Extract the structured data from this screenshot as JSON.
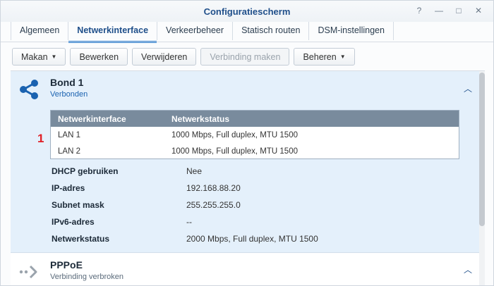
{
  "window": {
    "title": "Configuratiescherm"
  },
  "window_controls": [
    "?",
    "—",
    "□",
    "✕"
  ],
  "tabs": [
    {
      "label": "Algemeen",
      "active": false
    },
    {
      "label": "Netwerkinterface",
      "active": true
    },
    {
      "label": "Verkeerbeheer",
      "active": false
    },
    {
      "label": "Statisch routen",
      "active": false
    },
    {
      "label": "DSM-instellingen",
      "active": false
    }
  ],
  "toolbar": {
    "create": "Makan",
    "edit": "Bewerken",
    "delete": "Verwijderen",
    "connect": "Verbinding maken",
    "manage": "Beheren"
  },
  "bond": {
    "title": "Bond 1",
    "status": "Verbonden",
    "table": {
      "headers": [
        "Netwerkinterface",
        "Netwerkstatus"
      ],
      "rows": [
        [
          "LAN 1",
          "1000 Mbps, Full duplex, MTU 1500"
        ],
        [
          "LAN 2",
          "1000 Mbps, Full duplex, MTU 1500"
        ]
      ]
    },
    "marker": "1",
    "properties": [
      {
        "label": "DHCP gebruiken",
        "value": "Nee"
      },
      {
        "label": "IP-adres",
        "value": "192.168.88.20"
      },
      {
        "label": "Subnet mask",
        "value": "255.255.255.0"
      },
      {
        "label": "IPv6-adres",
        "value": "--"
      },
      {
        "label": "Netwerkstatus",
        "value": "2000 Mbps, Full duplex, MTU 1500"
      }
    ]
  },
  "pppoe": {
    "title": "PPPoE",
    "status": "Verbinding verbroken"
  },
  "colors": {
    "accent": "#2a7fd4",
    "title": "#1f4f8a",
    "selected_bg": "#e4f0fb",
    "table_header": "#798b9d",
    "marker": "#e01f26"
  }
}
